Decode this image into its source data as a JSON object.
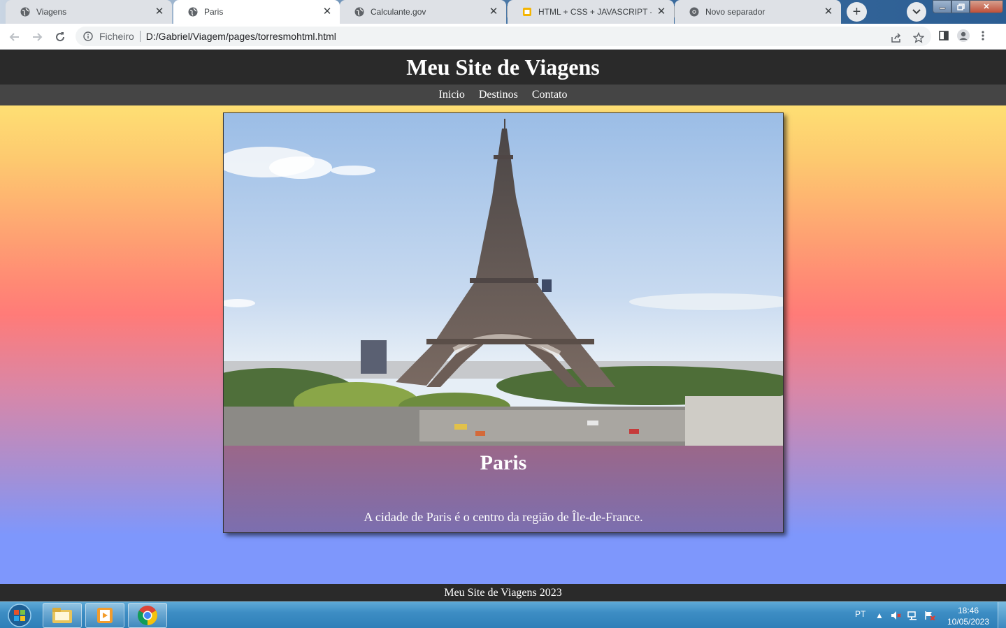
{
  "browser": {
    "tabs": [
      {
        "title": "Viagens",
        "active": false
      },
      {
        "title": "Paris",
        "active": true
      },
      {
        "title": "Calculante.gov",
        "active": false
      },
      {
        "title": "HTML + CSS + JAVASCRIPT - Goo",
        "active": false
      },
      {
        "title": "Novo separador",
        "active": false
      }
    ],
    "address": {
      "scheme_label": "Ficheiro",
      "url": "D:/Gabriel/Viagem/pages/torresmohtml.html"
    }
  },
  "site": {
    "title": "Meu Site de Viagens",
    "nav": [
      "Inicio",
      "Destinos",
      "Contato"
    ],
    "card": {
      "image_alt": "Torre Eiffel",
      "title": "Paris",
      "text": "A cidade de Paris é o centro da região de Île-de-France."
    },
    "footer": "Meu Site de Viagens 2023"
  },
  "taskbar": {
    "language": "PT",
    "time": "18:46",
    "date": "10/05/2023"
  },
  "colors": {
    "header_bg": "#2a2a2a",
    "nav_bg": "#454545",
    "gradient_top": "#fff678",
    "gradient_mid": "#ff7b78",
    "gradient_bottom": "#7e97fc"
  }
}
